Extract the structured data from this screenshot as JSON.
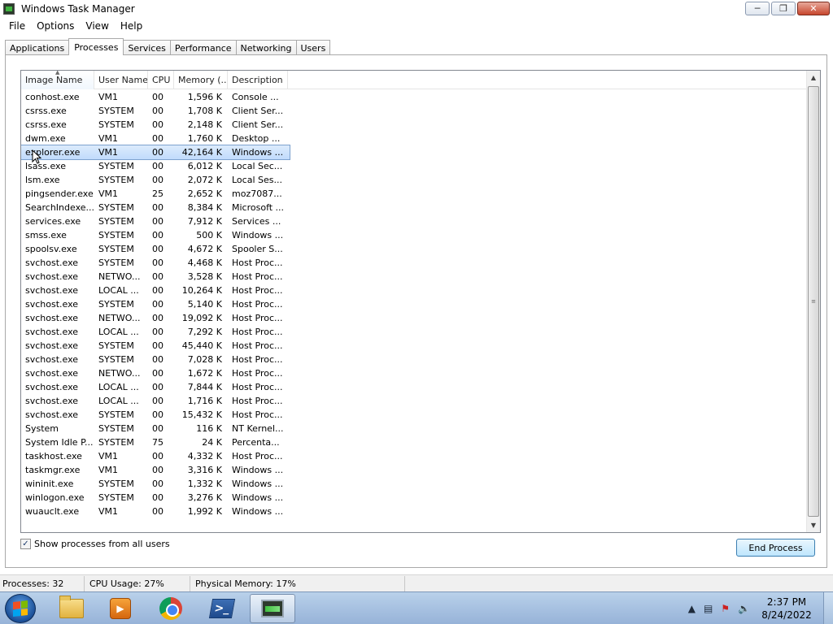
{
  "window": {
    "title": "Windows Task Manager",
    "controls": [
      "minimize",
      "maximize",
      "close"
    ]
  },
  "menu": [
    "File",
    "Options",
    "View",
    "Help"
  ],
  "tabs": [
    {
      "label": "Applications",
      "active": false
    },
    {
      "label": "Processes",
      "active": true
    },
    {
      "label": "Services",
      "active": false
    },
    {
      "label": "Performance",
      "active": false
    },
    {
      "label": "Networking",
      "active": false
    },
    {
      "label": "Users",
      "active": false
    }
  ],
  "processes": {
    "columns": [
      "Image Name",
      "User Name",
      "CPU",
      "Memory (...",
      "Description"
    ],
    "sorted_column": "Image Name",
    "selected_row": 4,
    "rows": [
      {
        "name": "conhost.exe",
        "user": "VM1",
        "cpu": "00",
        "memory": "1,596 K",
        "desc": "Console ..."
      },
      {
        "name": "csrss.exe",
        "user": "SYSTEM",
        "cpu": "00",
        "memory": "1,708 K",
        "desc": "Client Ser..."
      },
      {
        "name": "csrss.exe",
        "user": "SYSTEM",
        "cpu": "00",
        "memory": "2,148 K",
        "desc": "Client Ser..."
      },
      {
        "name": "dwm.exe",
        "user": "VM1",
        "cpu": "00",
        "memory": "1,760 K",
        "desc": "Desktop ..."
      },
      {
        "name": "explorer.exe",
        "user": "VM1",
        "cpu": "00",
        "memory": "42,164 K",
        "desc": "Windows ..."
      },
      {
        "name": "lsass.exe",
        "user": "SYSTEM",
        "cpu": "00",
        "memory": "6,012 K",
        "desc": "Local Sec..."
      },
      {
        "name": "lsm.exe",
        "user": "SYSTEM",
        "cpu": "00",
        "memory": "2,072 K",
        "desc": "Local Ses..."
      },
      {
        "name": "pingsender.exe",
        "user": "VM1",
        "cpu": "25",
        "memory": "2,652 K",
        "desc": "moz7087..."
      },
      {
        "name": "SearchIndexe...",
        "user": "SYSTEM",
        "cpu": "00",
        "memory": "8,384 K",
        "desc": "Microsoft ..."
      },
      {
        "name": "services.exe",
        "user": "SYSTEM",
        "cpu": "00",
        "memory": "7,912 K",
        "desc": "Services ..."
      },
      {
        "name": "smss.exe",
        "user": "SYSTEM",
        "cpu": "00",
        "memory": "500 K",
        "desc": "Windows ..."
      },
      {
        "name": "spoolsv.exe",
        "user": "SYSTEM",
        "cpu": "00",
        "memory": "4,672 K",
        "desc": "Spooler S..."
      },
      {
        "name": "svchost.exe",
        "user": "SYSTEM",
        "cpu": "00",
        "memory": "4,468 K",
        "desc": "Host Proc..."
      },
      {
        "name": "svchost.exe",
        "user": "NETWO...",
        "cpu": "00",
        "memory": "3,528 K",
        "desc": "Host Proc..."
      },
      {
        "name": "svchost.exe",
        "user": "LOCAL ...",
        "cpu": "00",
        "memory": "10,264 K",
        "desc": "Host Proc..."
      },
      {
        "name": "svchost.exe",
        "user": "SYSTEM",
        "cpu": "00",
        "memory": "5,140 K",
        "desc": "Host Proc..."
      },
      {
        "name": "svchost.exe",
        "user": "NETWO...",
        "cpu": "00",
        "memory": "19,092 K",
        "desc": "Host Proc..."
      },
      {
        "name": "svchost.exe",
        "user": "LOCAL ...",
        "cpu": "00",
        "memory": "7,292 K",
        "desc": "Host Proc..."
      },
      {
        "name": "svchost.exe",
        "user": "SYSTEM",
        "cpu": "00",
        "memory": "45,440 K",
        "desc": "Host Proc..."
      },
      {
        "name": "svchost.exe",
        "user": "SYSTEM",
        "cpu": "00",
        "memory": "7,028 K",
        "desc": "Host Proc..."
      },
      {
        "name": "svchost.exe",
        "user": "NETWO...",
        "cpu": "00",
        "memory": "1,672 K",
        "desc": "Host Proc..."
      },
      {
        "name": "svchost.exe",
        "user": "LOCAL ...",
        "cpu": "00",
        "memory": "7,844 K",
        "desc": "Host Proc..."
      },
      {
        "name": "svchost.exe",
        "user": "LOCAL ...",
        "cpu": "00",
        "memory": "1,716 K",
        "desc": "Host Proc..."
      },
      {
        "name": "svchost.exe",
        "user": "SYSTEM",
        "cpu": "00",
        "memory": "15,432 K",
        "desc": "Host Proc..."
      },
      {
        "name": "System",
        "user": "SYSTEM",
        "cpu": "00",
        "memory": "116 K",
        "desc": "NT Kernel..."
      },
      {
        "name": "System Idle P...",
        "user": "SYSTEM",
        "cpu": "75",
        "memory": "24 K",
        "desc": "Percenta..."
      },
      {
        "name": "taskhost.exe",
        "user": "VM1",
        "cpu": "00",
        "memory": "4,332 K",
        "desc": "Host Proc..."
      },
      {
        "name": "taskmgr.exe",
        "user": "VM1",
        "cpu": "00",
        "memory": "3,316 K",
        "desc": "Windows ..."
      },
      {
        "name": "wininit.exe",
        "user": "SYSTEM",
        "cpu": "00",
        "memory": "1,332 K",
        "desc": "Windows ..."
      },
      {
        "name": "winlogon.exe",
        "user": "SYSTEM",
        "cpu": "00",
        "memory": "3,276 K",
        "desc": "Windows ..."
      },
      {
        "name": "wuauclt.exe",
        "user": "VM1",
        "cpu": "00",
        "memory": "1,992 K",
        "desc": "Windows ..."
      }
    ]
  },
  "show_all_users": {
    "label": "Show processes from all users",
    "checked": true
  },
  "end_process_label": "End Process",
  "status": {
    "processes": "Processes: 32",
    "cpu": "CPU Usage: 27%",
    "memory": "Physical Memory: 17%"
  },
  "taskbar": {
    "pinned": [
      "start-orb",
      "windows-explorer-icon",
      "media-player-icon",
      "chrome-icon",
      "powershell-icon",
      "task-manager-icon"
    ],
    "active": "task-manager-icon",
    "tray_icons": [
      "show-hidden-icons-arrow",
      "network-icon",
      "action-center-flag-icon",
      "volume-icon"
    ],
    "time": "2:37 PM",
    "date": "8/24/2022"
  }
}
